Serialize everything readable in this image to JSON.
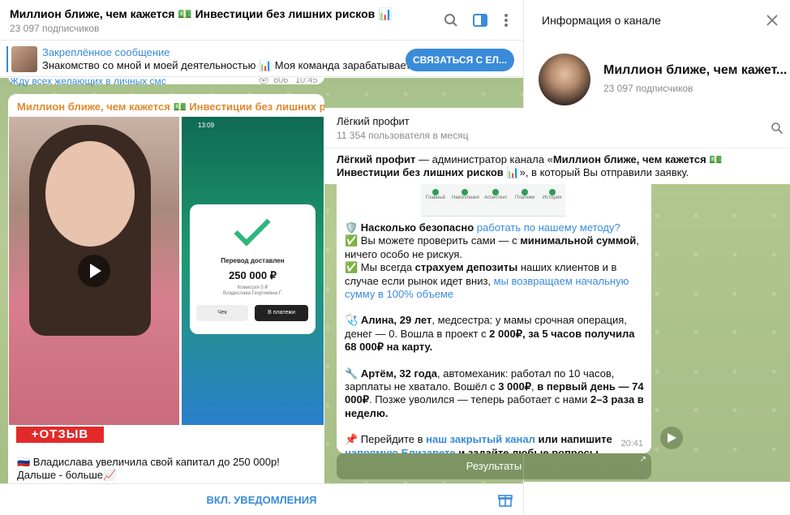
{
  "chat": {
    "title": "Миллион ближе, чем кажется 💵 Инвестиции без лишних рисков 📊",
    "subscribers": "23 097 подписчиков",
    "icons": [
      "search-icon",
      "sidebar-toggle-icon",
      "more-vertical-icon"
    ]
  },
  "pinned": {
    "title": "Закреплённое сообщение",
    "text": "Знакомство со мной и моей деятельностью 📊  Моя команда зарабатывает...",
    "button": "СВЯЗАТЬСЯ С ЕЛ..."
  },
  "prev_message": {
    "text": "Жду всех желающих в личных смс",
    "views": "806",
    "time": "10:45"
  },
  "post": {
    "title": "Миллион ближе, чем кажется 💵 Инвестиции без лишних р...",
    "badge": "+ОТЗЫВ",
    "text1": "🇷🇺 Владислава увеличила свой капитал до 250 000р!",
    "text2": "Дальше - больше📈",
    "phone": {
      "time": "13:09",
      "status": "Перевод доставлен",
      "amount": "250 000 ₽",
      "fee": "Комиссия 0 ₽",
      "recipient": "Владислава Георгиевна Г.",
      "btn_check": "Чек",
      "btn_payments": "В платежи"
    }
  },
  "footer": {
    "button": "ВКЛ. УВЕДОМЛЕНИЯ"
  },
  "info": {
    "title": "Информация о канале",
    "name": "Миллион ближе, чем кажет...",
    "subscribers": "23 097 подписчиков"
  },
  "overlay": {
    "channel": "Лёгкий профит",
    "stat": "11 354 пользователя в месяц",
    "admin_prefix": "Лёгкий профит",
    "admin_mid": " — администратор канала «",
    "admin_channel": "Миллион ближе, чем кажется 💵 Инвестиции без лишних рисков 📊",
    "admin_suffix": "», в который Вы отправили заявку.",
    "app_tabs": [
      "Главный",
      "Накопления",
      "Ассистент",
      "Платежи",
      "История"
    ],
    "lines": {
      "l1a": "🛡️ Насколько безопасно ",
      "l1b": "работать по нашему методу?",
      "l2a": "✅ Вы можете проверить сами — с ",
      "l2b": "минимальной суммой",
      "l2c": ", ничего особо не рискуя.",
      "l3a": "✅ Мы всегда ",
      "l3b": "страхуем депозиты",
      "l3c": " наших клиентов и в случае если рынок идет вниз, ",
      "l3d": "мы возвращаем начальную сумму в 100% объеме",
      "l4a": "🩺 ",
      "l4b": "Алина, 29 лет",
      "l4c": ", медсестра: у мамы срочная операция, денег — 0. Вошла в проект с ",
      "l4d": "2 000₽, за 5 часов получила 68 000₽ на карту.",
      "l5a": "🔧 ",
      "l5b": "Артём, 32 года",
      "l5c": ", автомеханик: работал по 10 часов, зарплаты не хватало. Вошёл с ",
      "l5d": "3 000₽",
      "l5e": ", ",
      "l5f": "в первый день — 74 000₽",
      "l5g": ". Позже уволился — теперь работает с нами ",
      "l5h": "2–3 раза в неделю.",
      "l6a": "📌 Перейдите в ",
      "l6b": "наш закрытый канал",
      "l6c": " или напишите ",
      "l6d": "напрямую Елизавете",
      "l6e": " и задайте любые вопросы."
    },
    "time": "20:41",
    "results_button": "Результаты"
  },
  "colors": {
    "accent": "#3a8bd9",
    "title_orange": "#e08a2e",
    "chat_bg": "#a8c08a",
    "badge_red": "#e22a2a"
  }
}
